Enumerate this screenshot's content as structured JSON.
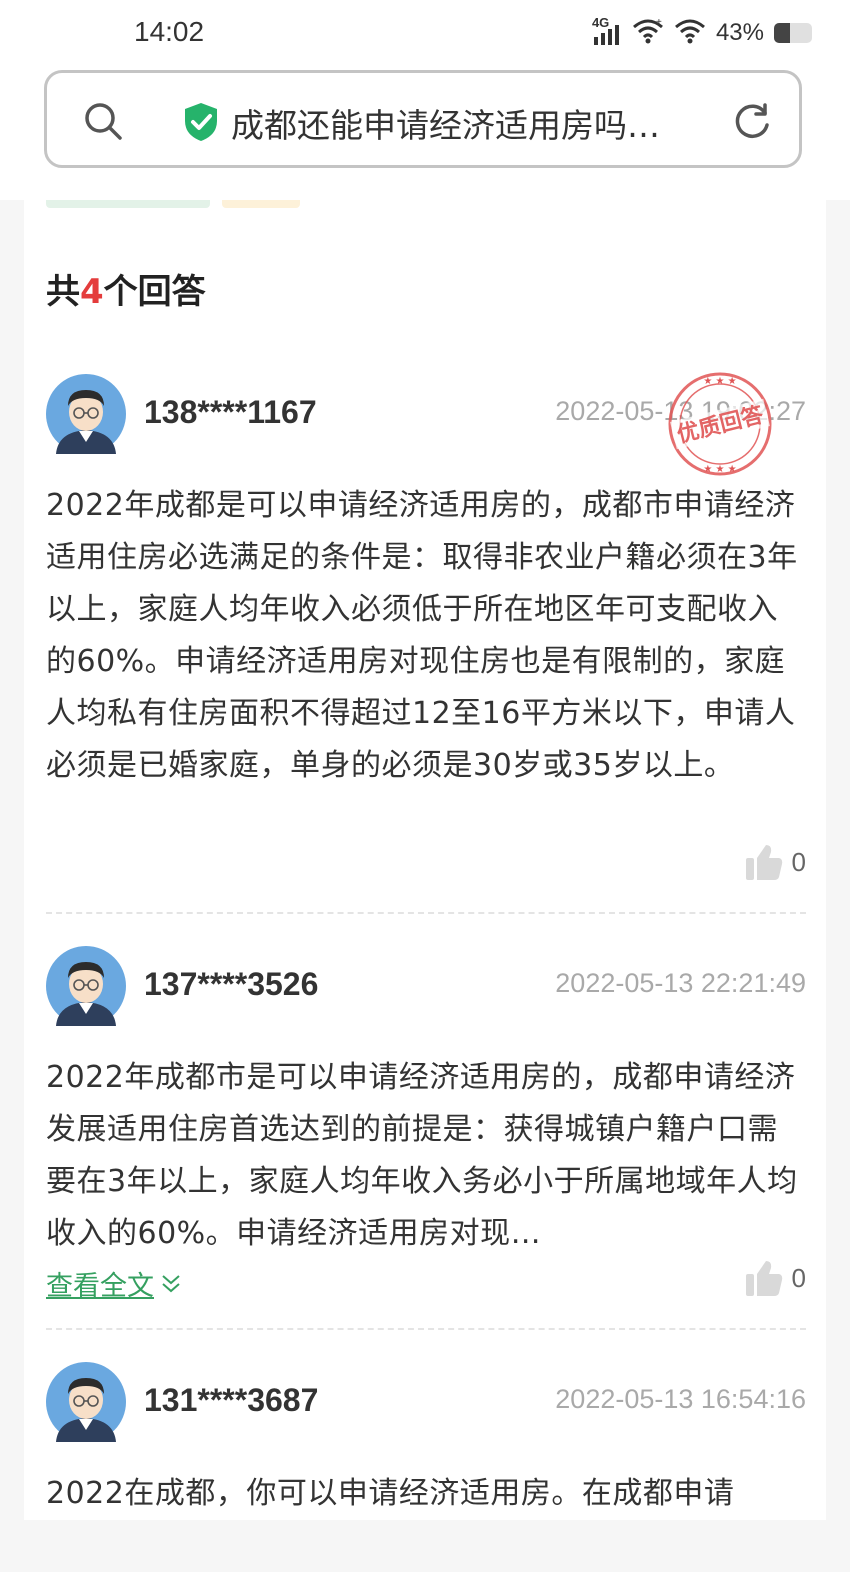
{
  "status": {
    "time": "14:02",
    "network": "4G",
    "battery_text": "43%",
    "battery_level": 0.43
  },
  "search": {
    "query": "成都还能申请经济适用房吗…",
    "icons": [
      "search-icon",
      "shield-check-icon",
      "refresh-icon"
    ],
    "shield_color": "#26b36b"
  },
  "answers_header": {
    "prefix": "共",
    "count": "4",
    "suffix": "个回答"
  },
  "answers": [
    {
      "user": "138****1167",
      "date": "2022-05-13 19:02:27",
      "badge": "优质回答",
      "text": "2022年成都是可以申请经济适用房的，成都市申请经济适用住房必选满足的条件是：取得非农业户籍必须在3年以上，家庭人均年收入必须低于所在地区年可支配收入的60%。申请经济适用房对现住房也是有限制的，家庭人均私有住房面积不得超过12至16平方米以下，申请人必须是已婚家庭，单身的必须是30岁或35岁以上。",
      "likes": "0"
    },
    {
      "user": "137****3526",
      "date": "2022-05-13 22:21:49",
      "text": "2022年成都市是可以申请经济适用房的，成都申请经济发展适用住房首选达到的前提是：获得城镇户籍户口需要在3年以上，家庭人均年收入务必小于所属地域年人均收入的60%。申请经济适用房对现…",
      "more": "查看全文",
      "likes": "0"
    },
    {
      "user": "131****3687",
      "date": "2022-05-13 16:54:16",
      "text": "2022在成都，你可以申请经济适用房。在成都申请"
    }
  ],
  "colors": {
    "accent_green": "#35a060",
    "count_red": "#e43c3c",
    "stamp_red": "#e05555"
  }
}
